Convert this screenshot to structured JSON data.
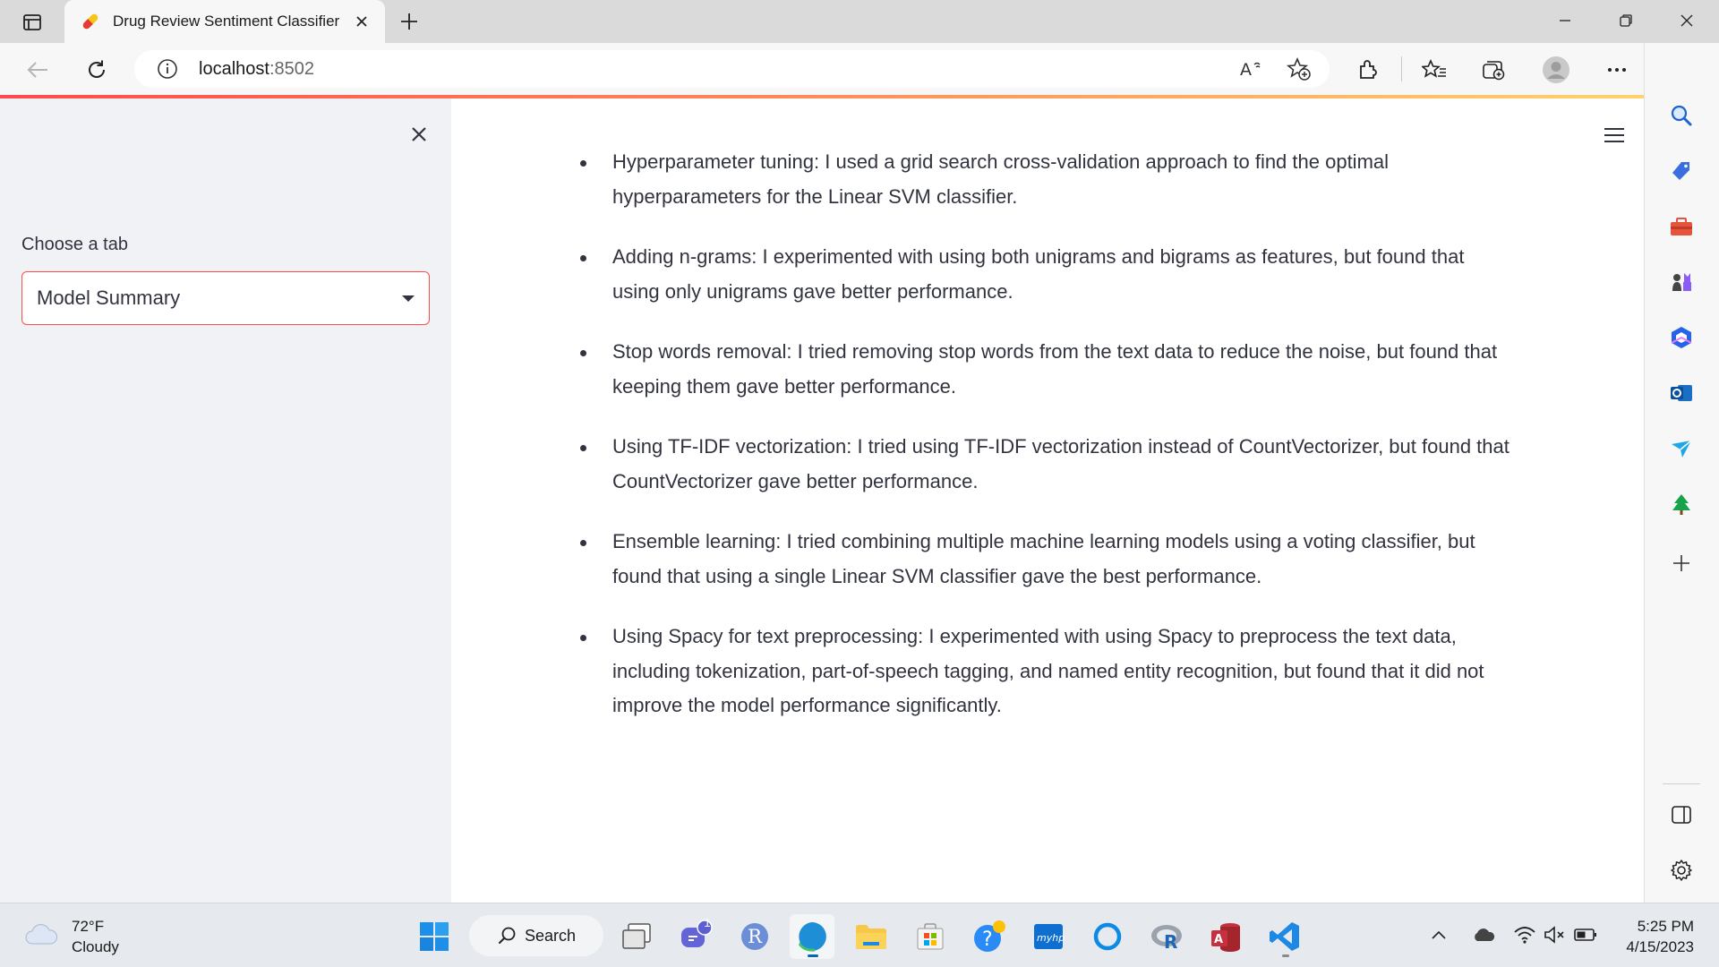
{
  "browser": {
    "tab_title": "Drug Review Sentiment Classifier",
    "url_host": "localhost",
    "url_port": ":8502",
    "icons": [
      "tab-actions-icon",
      "favicon",
      "close-icon",
      "plus-icon",
      "minimize-icon",
      "restore-icon",
      "close-icon",
      "back-icon",
      "refresh-icon",
      "info-icon",
      "read-aloud-icon",
      "add-favorite-icon",
      "extensions-icon",
      "favorites-icon",
      "collections-icon",
      "profile-icon",
      "more-icon",
      "bing-icon"
    ]
  },
  "sidebar": {
    "select_label": "Choose a tab",
    "select_value": "Model Summary",
    "accent": "#ff4b4b"
  },
  "main": {
    "items": [
      "Hyperparameter tuning: I used a grid search cross-validation approach to find the optimal hyperparameters for the Linear SVM classifier.",
      "Adding n-grams: I experimented with using both unigrams and bigrams as features, but found that using only unigrams gave better performance.",
      "Stop words removal: I tried removing stop words from the text data to reduce the noise, but found that keeping them gave better performance.",
      "Using TF-IDF vectorization: I tried using TF-IDF vectorization instead of CountVectorizer, but found that CountVectorizer gave better performance.",
      "Ensemble learning: I tried combining multiple machine learning models using a voting classifier, but found that using a single Linear SVM classifier gave the best performance.",
      "Using Spacy for text preprocessing: I experimented with using Spacy to preprocess the text data, including tokenization, part-of-speech tagging, and named entity recognition, but found that it did not improve the model performance significantly."
    ]
  },
  "taskbar": {
    "weather_temp": "72°F",
    "weather_desc": "Cloudy",
    "search_label": "Search",
    "teams_badge": "1",
    "r_label": "R",
    "time": "5:25 PM",
    "date": "4/15/2023"
  }
}
